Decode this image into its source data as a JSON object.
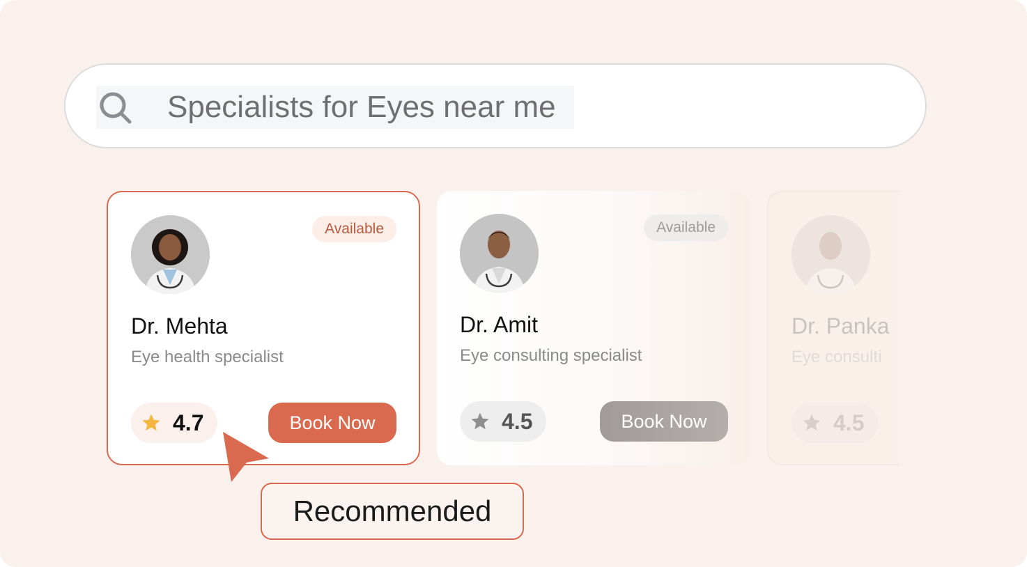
{
  "search": {
    "query": "Specialists for Eyes near me",
    "icon": "search-icon"
  },
  "doctors": [
    {
      "name": "Dr. Mehta",
      "specialty": "Eye health specialist",
      "status": "Available",
      "rating": "4.7",
      "book_label": "Book Now",
      "highlighted": true
    },
    {
      "name": "Dr. Amit",
      "specialty": "Eye consulting specialist",
      "status": "Available",
      "rating": "4.5",
      "book_label": "Book Now",
      "highlighted": false
    },
    {
      "name": "Dr. Panka",
      "specialty": "Eye consulti",
      "rating": "4.5",
      "highlighted": false
    }
  ],
  "recommended_label": "Recommended",
  "colors": {
    "accent": "#d96a4f",
    "background": "#faf1ec",
    "star": "#f4b63f",
    "muted": "#8a8a8a"
  }
}
